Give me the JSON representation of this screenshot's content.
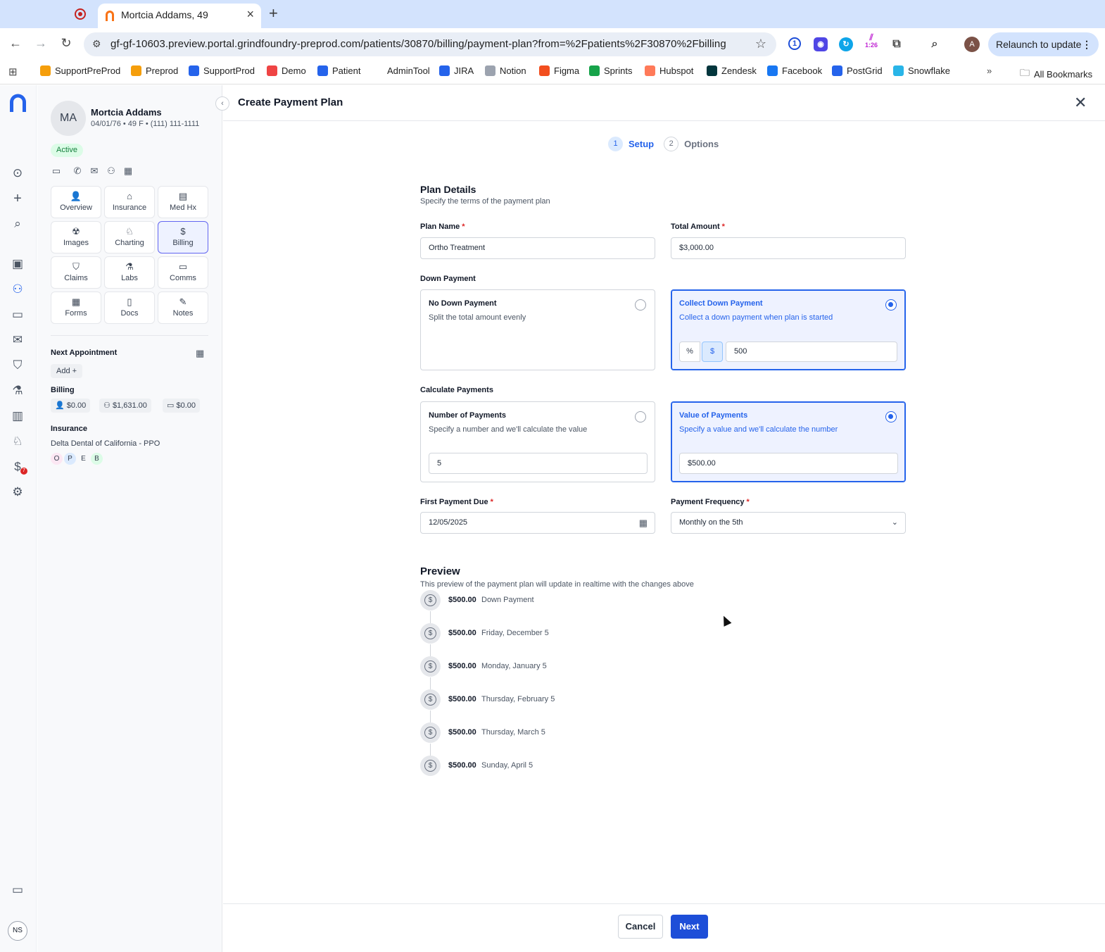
{
  "browser": {
    "tab_title": "Mortcia Addams, 49",
    "url": "gf-gf-10603.preview.portal.grindfoundry-preprod.com/patients/30870/billing/payment-plan?from=%2Fpatients%2F30870%2Fbilling",
    "ext_time": "1:26",
    "profile_initial": "A",
    "relaunch_label": "Relaunch to update",
    "bookmarks": [
      {
        "label": "SupportPreProd",
        "color": "#f59e0b"
      },
      {
        "label": "Preprod",
        "color": "#f59e0b"
      },
      {
        "label": "SupportProd",
        "color": "#2563eb"
      },
      {
        "label": "Demo",
        "color": "#ef4444"
      },
      {
        "label": "Patient",
        "color": "#2563eb"
      },
      {
        "label": "AdminTool",
        "color": ""
      },
      {
        "label": "JIRA",
        "color": "#2563eb"
      },
      {
        "label": "Notion",
        "color": "#9ca3af"
      },
      {
        "label": "Figma",
        "color": "#f24e1e"
      },
      {
        "label": "Sprints",
        "color": "#16a34a"
      },
      {
        "label": "Hubspot",
        "color": "#ff7a59"
      },
      {
        "label": "Zendesk",
        "color": "#03363d"
      },
      {
        "label": "Facebook",
        "color": "#1877f2"
      },
      {
        "label": "PostGrid",
        "color": "#2563eb"
      },
      {
        "label": "Snowflake",
        "color": "#29b5e8"
      }
    ],
    "overflow_label": "»",
    "all_bookmarks_label": "All Bookmarks"
  },
  "rail": {
    "user_initials": "NS",
    "badge_count": "7"
  },
  "patient": {
    "initials": "MA",
    "name": "Mortcia Addams",
    "meta": "04/01/76 • 49 F • (111) 111-1111",
    "status": "Active",
    "nav": [
      {
        "label": "Overview",
        "icon": "person-icon",
        "glyph": "👤"
      },
      {
        "label": "Insurance",
        "icon": "shield-home-icon",
        "glyph": "⌂"
      },
      {
        "label": "Med Hx",
        "icon": "clipboard-icon",
        "glyph": "▤"
      },
      {
        "label": "Images",
        "icon": "radiation-icon",
        "glyph": "☢"
      },
      {
        "label": "Charting",
        "icon": "tooth-icon",
        "glyph": "♘"
      },
      {
        "label": "Billing",
        "icon": "billing-icon",
        "glyph": "$"
      },
      {
        "label": "Claims",
        "icon": "claims-shield-icon",
        "glyph": "⛉"
      },
      {
        "label": "Labs",
        "icon": "flask-icon",
        "glyph": "⚗"
      },
      {
        "label": "Comms",
        "icon": "chat-icon",
        "glyph": "▭"
      },
      {
        "label": "Forms",
        "icon": "forms-icon",
        "glyph": "▦"
      },
      {
        "label": "Docs",
        "icon": "document-icon",
        "glyph": "▯"
      },
      {
        "label": "Notes",
        "icon": "notes-icon",
        "glyph": "✎"
      }
    ],
    "next_appt_title": "Next Appointment",
    "add_label": "Add",
    "billing_title": "Billing",
    "billing": [
      "$0.00",
      "$1,631.00",
      "$0.00"
    ],
    "insurance_title": "Insurance",
    "insurance_name": "Delta Dental of California - PPO",
    "insurance_badges": [
      {
        "letter": "O",
        "color": "#fce7f3"
      },
      {
        "letter": "P",
        "color": "#dbeafe"
      },
      {
        "letter": "E",
        "color": "transparent"
      },
      {
        "letter": "B",
        "color": "#dcfce7"
      }
    ]
  },
  "main": {
    "title": "Create Payment Plan",
    "steps": [
      {
        "num": "1",
        "label": "Setup",
        "active": true
      },
      {
        "num": "2",
        "label": "Options",
        "active": false
      }
    ],
    "plan_details_title": "Plan Details",
    "plan_details_sub": "Specify the terms of the payment plan",
    "plan_name_label": "Plan Name",
    "plan_name_value": "Ortho Treatment",
    "total_amount_label": "Total Amount",
    "total_amount_value": "$3,000.00",
    "down_payment_label": "Down Payment",
    "no_down_title": "No Down Payment",
    "no_down_desc": "Split the total amount evenly",
    "collect_down_title": "Collect Down Payment",
    "collect_down_desc": "Collect a down payment when plan is started",
    "percent_label": "%",
    "dollar_label": "$",
    "down_value": "500",
    "calc_label": "Calculate Payments",
    "num_payments_title": "Number of Payments",
    "num_payments_desc": "Specify a number and we'll calculate the value",
    "num_payments_value": "5",
    "value_payments_title": "Value of Payments",
    "value_payments_desc": "Specify a value and we'll calculate the number",
    "value_payments_value": "$500.00",
    "first_due_label": "First Payment Due",
    "first_due_value": "12/05/2025",
    "frequency_label": "Payment Frequency",
    "frequency_value": "Monthly on the 5th",
    "preview_title": "Preview",
    "preview_sub": "This preview of the payment plan will update in realtime with the changes above",
    "schedule": [
      {
        "amount": "$500.00",
        "label": "Down Payment"
      },
      {
        "amount": "$500.00",
        "label": "Friday, December 5"
      },
      {
        "amount": "$500.00",
        "label": "Monday, January 5"
      },
      {
        "amount": "$500.00",
        "label": "Thursday, February 5"
      },
      {
        "amount": "$500.00",
        "label": "Thursday, March 5"
      },
      {
        "amount": "$500.00",
        "label": "Sunday, April 5"
      }
    ],
    "cancel_label": "Cancel",
    "next_label": "Next"
  }
}
